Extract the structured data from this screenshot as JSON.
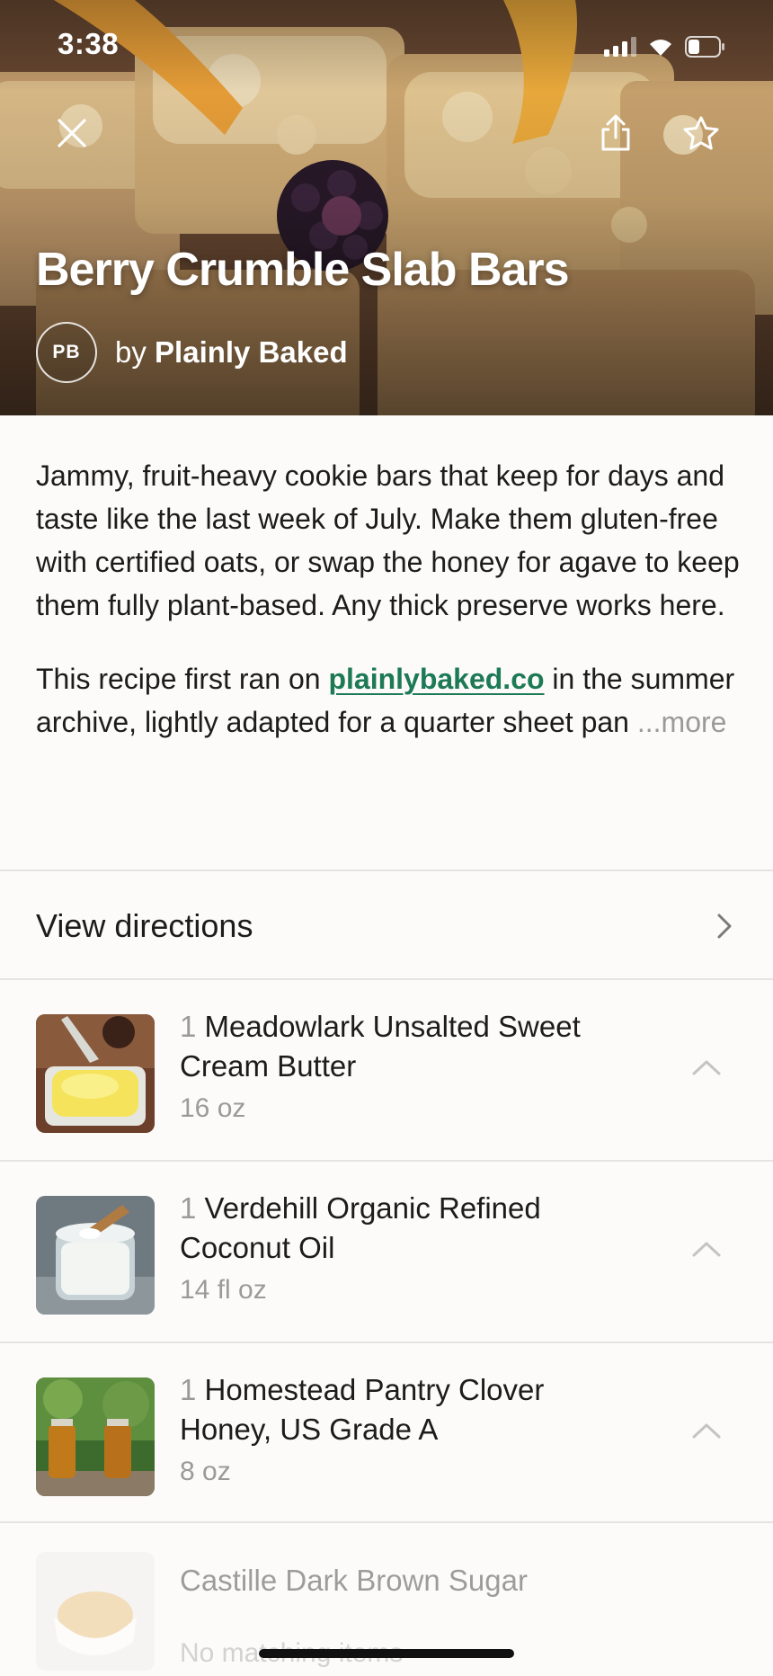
{
  "status_bar": {
    "time": "3:38"
  },
  "hero": {
    "title": "Berry Crumble Slab Bars",
    "author_initials": "PB",
    "author_prefix": "by",
    "author_name": "Plainly Baked"
  },
  "description": {
    "paragraph1": "Jammy, fruit-heavy cookie bars that keep for days and taste like the last week of July. Make them gluten-free with certified oats, or swap the honey for agave to keep them fully plant-based. Any thick preserve works here.",
    "paragraph2_before": "This recipe first ran on ",
    "paragraph2_link": "plainlybaked.co",
    "paragraph2_after": " in the summer archive, lightly adapted for a quarter sheet pan ",
    "more_label": "...more"
  },
  "directions": {
    "label": "View directions"
  },
  "ingredients": [
    {
      "qty": "1",
      "name": "Meadowlark Unsalted Sweet Cream Butter",
      "size": "16 oz",
      "thumb_icon": "butter-photo"
    },
    {
      "qty": "1",
      "name": "Verdehill Organic Refined Coconut Oil",
      "size": "14 fl oz",
      "thumb_icon": "coconut-oil-photo"
    },
    {
      "qty": "1",
      "name": "Homestead Pantry Clover Honey, US Grade A",
      "size": "8 oz",
      "thumb_icon": "honey-jars-photo"
    },
    {
      "name": "Castille Dark Brown Sugar",
      "status": "No matching items",
      "thumb_icon": "brown-sugar-photo"
    }
  ],
  "colors": {
    "link": "#1d7a55",
    "muted": "#9a9a9a",
    "background": "#fcfbf9"
  }
}
